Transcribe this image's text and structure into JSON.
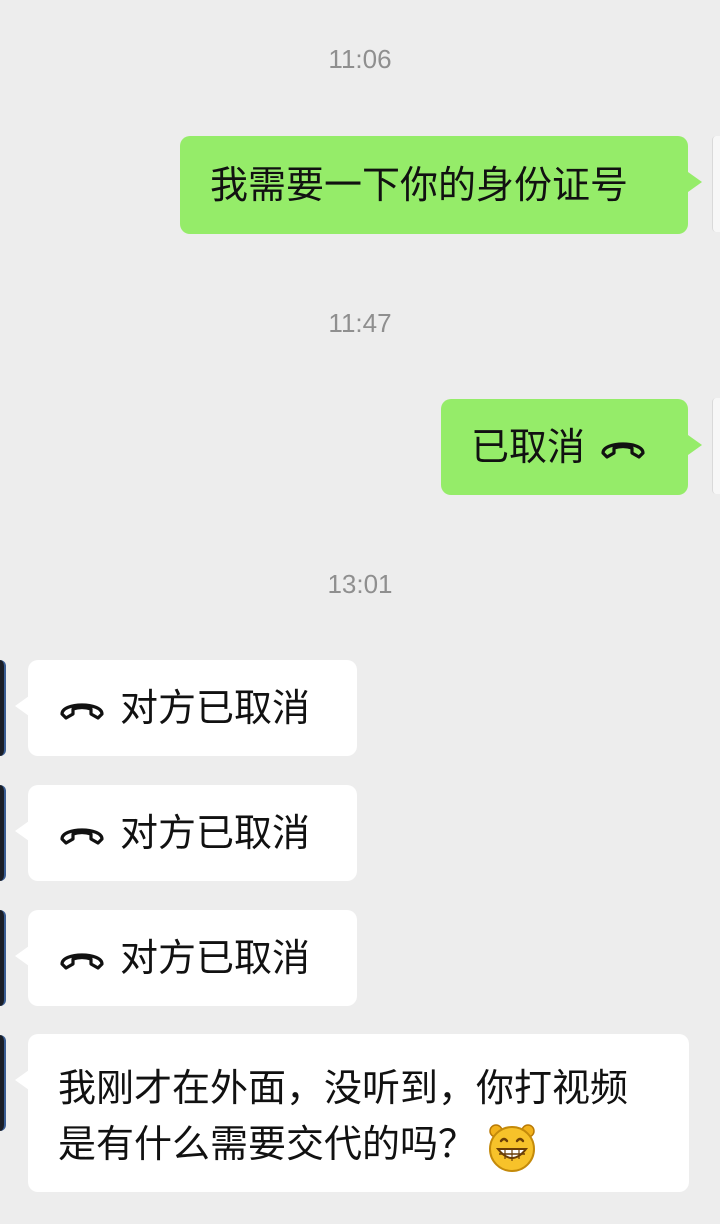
{
  "chat": {
    "messages": [
      {
        "type": "time",
        "text": "11:06"
      },
      {
        "type": "outgoing",
        "text": "我需要一下你的身份证号"
      },
      {
        "type": "time",
        "text": "11:47"
      },
      {
        "type": "outgoing_call",
        "text": "已取消",
        "icon": "phone-hangup-icon"
      },
      {
        "type": "time",
        "text": "13:01"
      },
      {
        "type": "incoming_call",
        "text": "对方已取消",
        "icon": "phone-hangup-icon"
      },
      {
        "type": "incoming_call",
        "text": "对方已取消",
        "icon": "phone-hangup-icon"
      },
      {
        "type": "incoming_call",
        "text": "对方已取消",
        "icon": "phone-hangup-icon"
      },
      {
        "type": "incoming",
        "line1": "我刚才在外面，没听到，你打视频",
        "line2": "是有什么需要交代的吗？",
        "emoji": "grinning-face-emoji"
      }
    ]
  },
  "colors": {
    "background": "#ededed",
    "outgoing_bubble": "#95ec69",
    "incoming_bubble": "#ffffff",
    "timestamp_text": "#8f8f8f"
  }
}
